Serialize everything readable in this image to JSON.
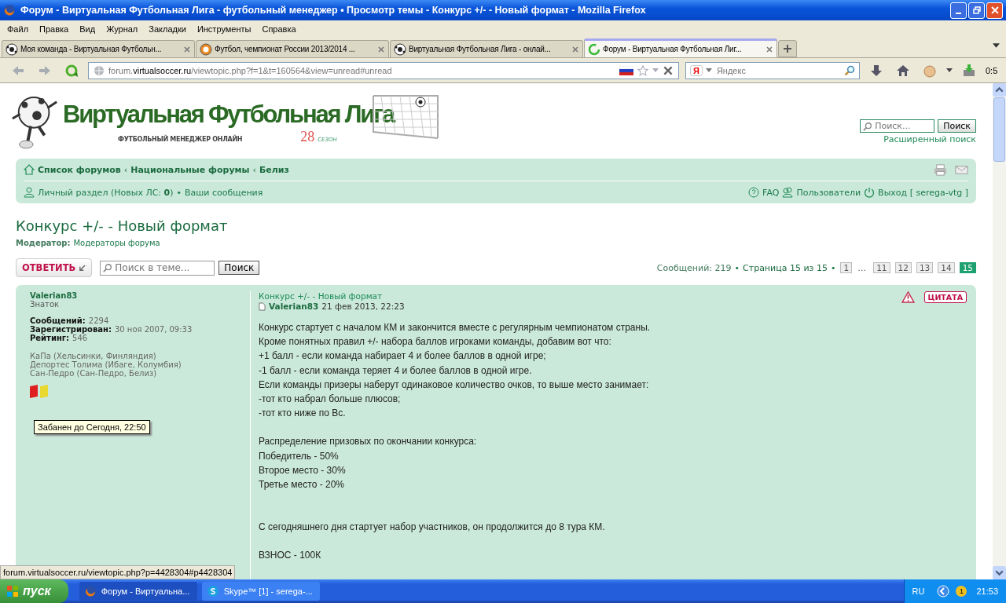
{
  "window": {
    "title": "Форум - Виртуальная Футбольная Лига - футбольный менеджер • Просмотр темы - Конкурс +/- - Новый формат - Mozilla Firefox"
  },
  "menu": [
    "Файл",
    "Правка",
    "Вид",
    "Журнал",
    "Закладки",
    "Инструменты",
    "Справка"
  ],
  "tabs": [
    {
      "label": "Моя команда - Виртуальная Футбольн...",
      "selected": false,
      "kind": "ball"
    },
    {
      "label": "Футбол, чемпионат России 2013/2014 ...",
      "selected": false,
      "kind": "club"
    },
    {
      "label": "Виртуальная Футбольная Лига - онлай...",
      "selected": false,
      "kind": "ball"
    },
    {
      "label": "Форум - Виртуальная Футбольная Лиг...",
      "selected": true,
      "kind": "loading"
    }
  ],
  "address": {
    "prefix": "forum.",
    "host": "virtualsoccer.ru",
    "path": "/viewtopic.php?f=1&t=160564&view=unread#unread"
  },
  "search_engine": {
    "logo": "Я",
    "placeholder": "Яндекс"
  },
  "addon_counter": "0:5",
  "site": {
    "logo_title": "Виртуальная Футбольная Лига",
    "logo_subtitle": "ФУТБОЛЬНЫЙ МЕНЕДЖЕР ОНЛАЙН",
    "season_number": "28",
    "season_label": "СЕЗОН",
    "search_placeholder": "Поиск...",
    "search_button": "Поиск",
    "advanced_search": "Расширенный поиск"
  },
  "breadcrumbs": {
    "separator": "‹",
    "items": [
      "Список форумов",
      "Национальные форумы",
      "Белиз"
    ]
  },
  "user_links": {
    "personal": "Личный раздел (Новых ЛС: **0**)",
    "bullet": "•",
    "posts": "Ваши сообщения",
    "faq": "FAQ",
    "users": "Пользователи",
    "logout": "Выход [ serega-vtg ]"
  },
  "topic": {
    "title": "Конкурс +/- - Новый формат",
    "moderator_label": "Модератор:",
    "moderator": "Модераторы форума"
  },
  "actions": {
    "reply": "ОТВЕТИТЬ",
    "search_placeholder": "Поиск в теме...",
    "search_button": "Поиск"
  },
  "pagination": {
    "summary": "Сообщений: 219",
    "bullet": "•",
    "page_info": "Страница 15 из 15",
    "pages": [
      {
        "label": "1",
        "kind": "page",
        "selected": false
      },
      {
        "label": "…",
        "kind": "gap"
      },
      {
        "label": "11",
        "kind": "page",
        "selected": false
      },
      {
        "label": "12",
        "kind": "page",
        "selected": false
      },
      {
        "label": "13",
        "kind": "page",
        "selected": false
      },
      {
        "label": "14",
        "kind": "page",
        "selected": false
      },
      {
        "label": "15",
        "kind": "page",
        "selected": true
      }
    ]
  },
  "post": {
    "author": "Valerian83",
    "rank": "Знаток",
    "stats": [
      {
        "label": "Сообщений:",
        "value": "2294"
      },
      {
        "label": "Зарегистрирован:",
        "value": "30 ноя 2007, 09:33"
      },
      {
        "label": "Рейтинг:",
        "value": "546"
      }
    ],
    "teams": [
      "КаПа (Хельсинки, Финляндия)",
      "Депортес Толима (Ибаге, Колумбия)",
      "Сан-Педро (Сан-Педро, Белиз)"
    ],
    "cards": [
      {
        "color": "#e02020"
      },
      {
        "color": "#e8d830"
      }
    ],
    "tooltip": "Забанен до Сегодня, 22:50",
    "subject": "Конкурс +/- - Новый формат",
    "post_author": "Valerian83",
    "date": "21 фев 2013, 22:23",
    "quote": "ЦИТАТА",
    "blocks": [
      {
        "kind": "first",
        "lines": [
          "Конкурс стартует с началом КМ и закончится вместе с регулярным чемпионатом страны.",
          "Кроме понятных правил +/- набора баллов игроками команды, добавим вот что:",
          "+1 балл - если команда набирает 4 и более баллов в одной игре;",
          "-1 балл - если команда теряет 4 и более баллов в одной игре.",
          "Если команды призеры наберут одинаковое количество очков, то выше место занимает:",
          "-тот кто набрал больше плюсов;",
          "-тот кто ниже по Вс."
        ]
      },
      {
        "kind": "after_break",
        "lines": [
          "Распределение призовых по окончании конкурса:",
          "Победитель - 50%",
          "Второе место - 30%",
          "Третье место - 20%"
        ]
      },
      {
        "kind": "after_long_break",
        "lines": [
          "С сегодняшнего дня стартует набор участников, он продолжится до 8 тура КМ."
        ]
      },
      {
        "kind": "after_break",
        "lines": [
          "ВЗНОС - 100К"
        ]
      }
    ]
  },
  "status_bar": "forum.virtualsoccer.ru/viewtopic.php?p=4428304#p4428304",
  "taskbar": {
    "start": "пуск",
    "tasks": [
      {
        "label": "Форум - Виртуальна...",
        "selected": true,
        "kind": "firefox"
      },
      {
        "label": "Skype™ [1] - serega-...",
        "selected": false,
        "kind": "skype"
      }
    ],
    "language": "RU",
    "badge": "1",
    "clock": "21:53"
  }
}
